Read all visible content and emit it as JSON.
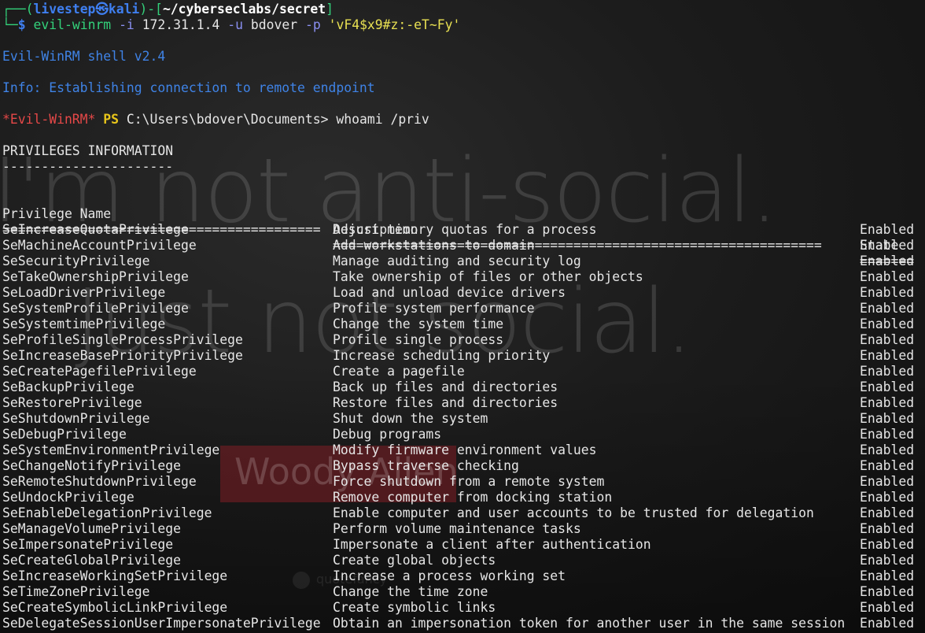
{
  "prompt": {
    "corner_top": "┌──",
    "paren_open": "(",
    "user": "livestep",
    "at_symbol": "㉿",
    "host": "kali",
    "paren_close": ")",
    "bracket_sep": "-[",
    "cwd": "~/cyberseclabs/secret",
    "bracket_close": "]",
    "corner_bottom": "└─",
    "dollar": "$",
    "command": "evil-winrm",
    "flag_i": "-i",
    "ip": "172.31.1.4",
    "flag_u": "-u",
    "username": "bdover",
    "flag_p": "-p",
    "password": "'vF4$x9#z:-eT~Fy'"
  },
  "banner": "Evil-WinRM shell v2.4",
  "info": "Info: Establishing connection to remote endpoint",
  "ps_prompt": {
    "name": "*Evil-WinRM*",
    "ps": "PS",
    "path": "C:\\Users\\bdover\\Documents>",
    "command": "whoami /priv"
  },
  "section_title": "PRIVILEGES INFORMATION",
  "section_underline": "----------------------",
  "headers": {
    "name": "Privilege Name",
    "description": "Description",
    "state": "State"
  },
  "separators": {
    "name": "=========================================",
    "description": "===============================================================",
    "state": "======="
  },
  "privileges": [
    {
      "name": "SeIncreaseQuotaPrivilege",
      "description": "Adjust memory quotas for a process",
      "state": "Enabled"
    },
    {
      "name": "SeMachineAccountPrivilege",
      "description": "Add workstations to domain",
      "state": "Enabled"
    },
    {
      "name": "SeSecurityPrivilege",
      "description": "Manage auditing and security log",
      "state": "Enabled"
    },
    {
      "name": "SeTakeOwnershipPrivilege",
      "description": "Take ownership of files or other objects",
      "state": "Enabled"
    },
    {
      "name": "SeLoadDriverPrivilege",
      "description": "Load and unload device drivers",
      "state": "Enabled"
    },
    {
      "name": "SeSystemProfilePrivilege",
      "description": "Profile system performance",
      "state": "Enabled"
    },
    {
      "name": "SeSystemtimePrivilege",
      "description": "Change the system time",
      "state": "Enabled"
    },
    {
      "name": "SeProfileSingleProcessPrivilege",
      "description": "Profile single process",
      "state": "Enabled"
    },
    {
      "name": "SeIncreaseBasePriorityPrivilege",
      "description": "Increase scheduling priority",
      "state": "Enabled"
    },
    {
      "name": "SeCreatePagefilePrivilege",
      "description": "Create a pagefile",
      "state": "Enabled"
    },
    {
      "name": "SeBackupPrivilege",
      "description": "Back up files and directories",
      "state": "Enabled"
    },
    {
      "name": "SeRestorePrivilege",
      "description": "Restore files and directories",
      "state": "Enabled"
    },
    {
      "name": "SeShutdownPrivilege",
      "description": "Shut down the system",
      "state": "Enabled"
    },
    {
      "name": "SeDebugPrivilege",
      "description": "Debug programs",
      "state": "Enabled"
    },
    {
      "name": "SeSystemEnvironmentPrivilege",
      "description": "Modify firmware environment values",
      "state": "Enabled"
    },
    {
      "name": "SeChangeNotifyPrivilege",
      "description": "Bypass traverse checking",
      "state": "Enabled"
    },
    {
      "name": "SeRemoteShutdownPrivilege",
      "description": "Force shutdown from a remote system",
      "state": "Enabled"
    },
    {
      "name": "SeUndockPrivilege",
      "description": "Remove computer from docking station",
      "state": "Enabled"
    },
    {
      "name": "SeEnableDelegationPrivilege",
      "description": "Enable computer and user accounts to be trusted for delegation",
      "state": "Enabled"
    },
    {
      "name": "SeManageVolumePrivilege",
      "description": "Perform volume maintenance tasks",
      "state": "Enabled"
    },
    {
      "name": "SeImpersonatePrivilege",
      "description": "Impersonate a client after authentication",
      "state": "Enabled"
    },
    {
      "name": "SeCreateGlobalPrivilege",
      "description": "Create global objects",
      "state": "Enabled"
    },
    {
      "name": "SeIncreaseWorkingSetPrivilege",
      "description": "Increase a process working set",
      "state": "Enabled"
    },
    {
      "name": "SeTimeZonePrivilege",
      "description": "Change the time zone",
      "state": "Enabled"
    },
    {
      "name": "SeCreateSymbolicLinkPrivilege",
      "description": "Create symbolic links",
      "state": "Enabled"
    },
    {
      "name": "SeDelegateSessionUserImpersonatePrivilege",
      "description": "Obtain an impersonation token for another user in the same session",
      "state": "Enabled"
    }
  ],
  "wallpaper": {
    "line1": "I'm not anti-social.",
    "line2": "Just not social.",
    "badge": "Woody Allen",
    "quote_site": "quotefancy"
  },
  "colors": {
    "background": "#1c1c1c",
    "prompt_green": "#33d17a",
    "prompt_blue": "#3f7ff0",
    "info_blue": "#3f83e6",
    "evilwinrm_red": "#e54848",
    "ps_yellow": "#e9c61a",
    "string_yellow": "#e8e052",
    "text": "#e6e6e6"
  }
}
